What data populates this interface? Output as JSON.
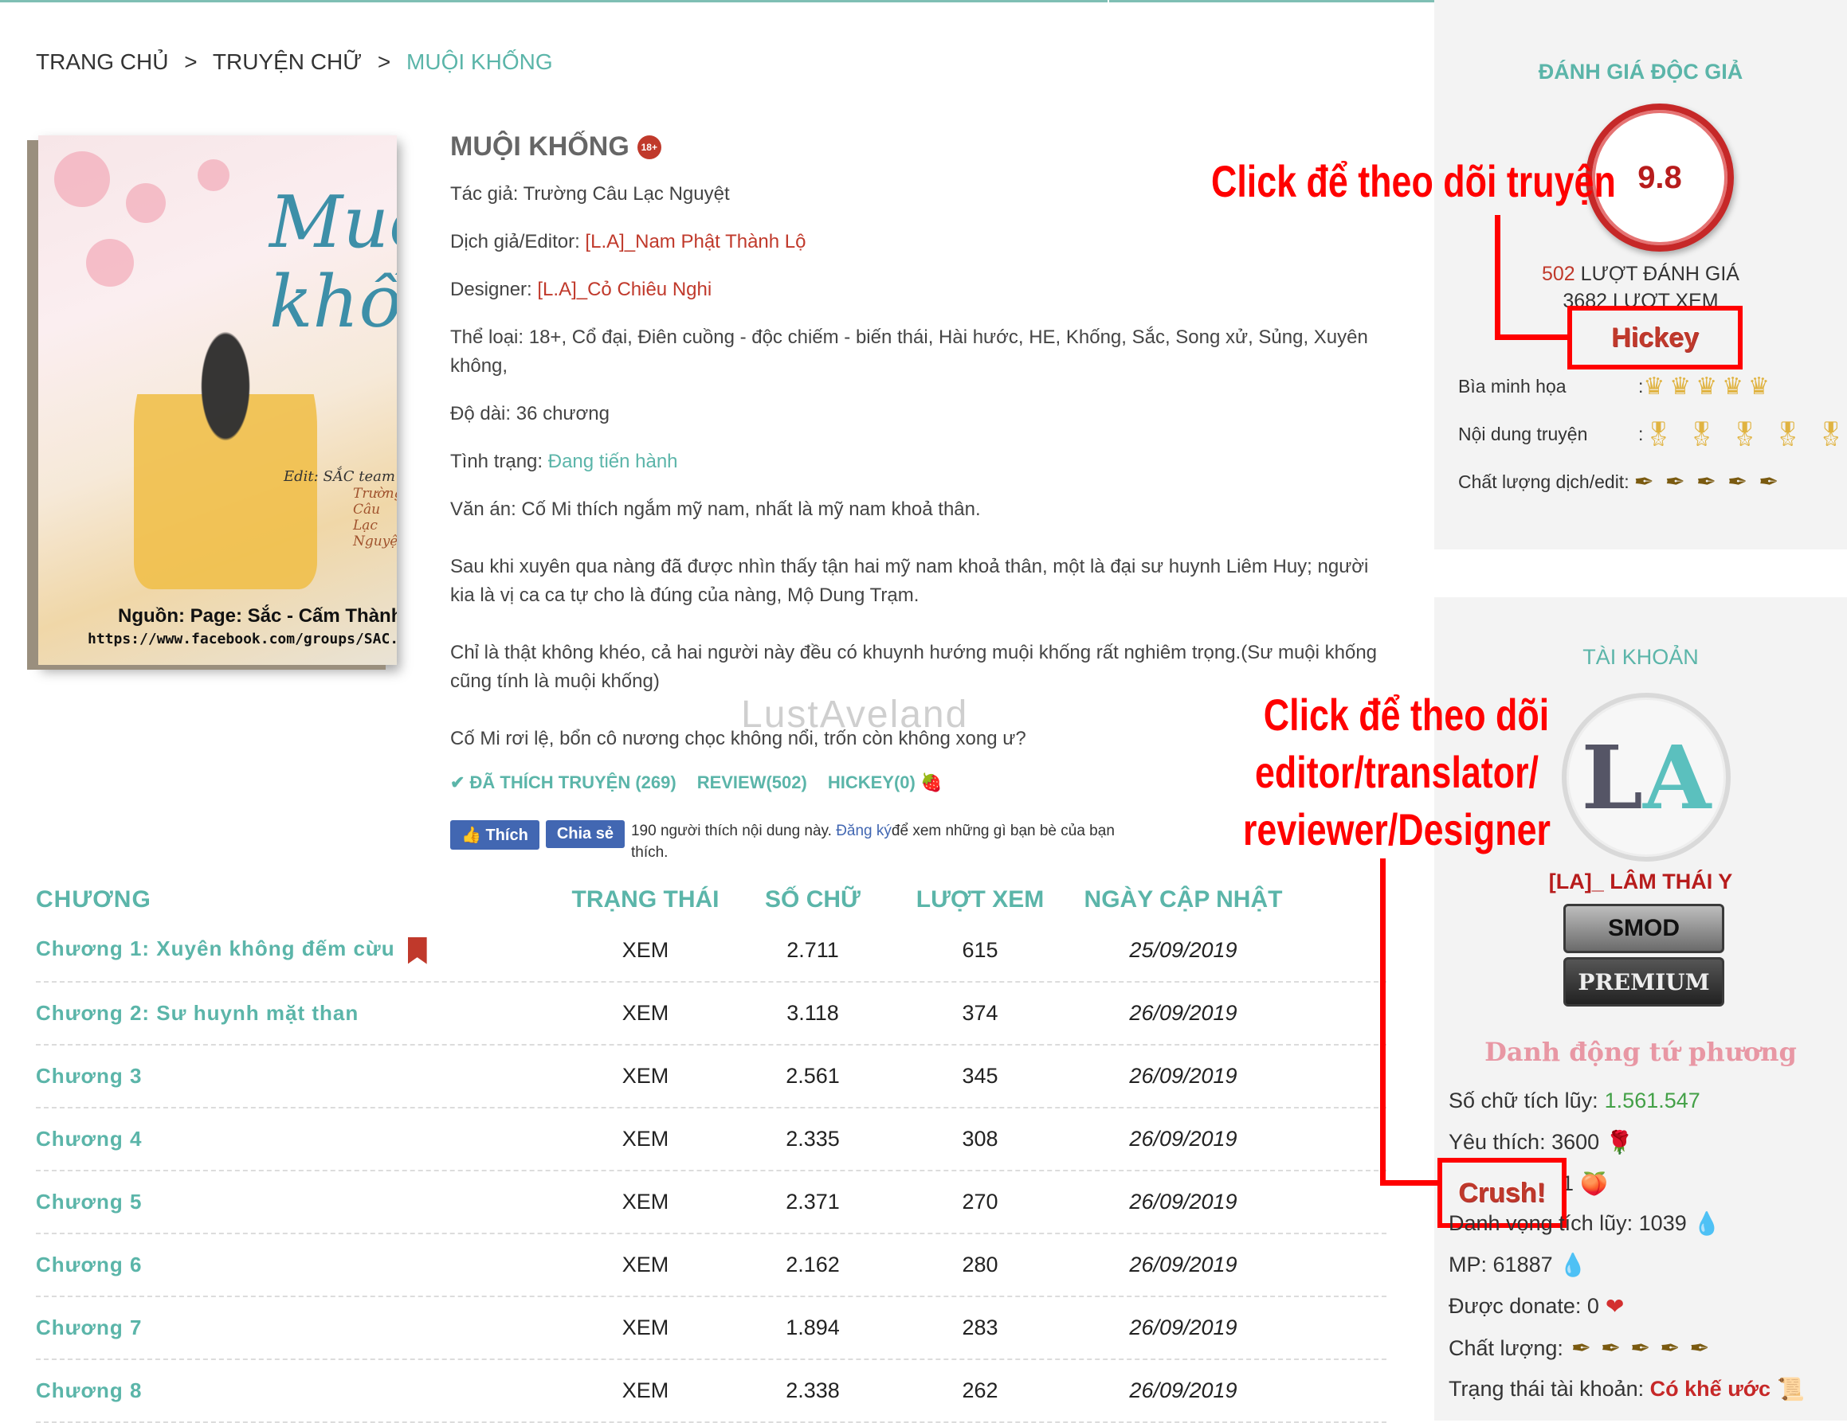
{
  "breadcrumb": {
    "home": "TRANG CHỦ",
    "category": "TRUYỆN CHỮ",
    "current": "MUỘI KHỐNG",
    "sep": ">"
  },
  "book": {
    "title": "MUỘI KHỐNG",
    "age_badge": "18+",
    "author_label": "Tác giả:",
    "author": "Trường Câu Lạc Nguyệt",
    "editor_label": "Dịch giả/Editor:",
    "editor": "[L.A]_Nam Phật Thành Lộ",
    "designer_label": "Designer:",
    "designer": "[L.A]_Cỏ Chiêu Nghi",
    "genre_label": "Thể loại:",
    "genre": "18+, Cổ đại, Điên cuồng - độc chiếm - biến thái, Hài hước, HE, Khống, Sắc, Song xử, Sủng, Xuyên không,",
    "length_label": "Độ dài:",
    "length": "36 chương",
    "status_label": "Tình trạng:",
    "status": "Đang tiến hành",
    "synopsis_label": "Văn án:",
    "synopsis": [
      "Cố Mi thích ngắm mỹ nam, nhất là mỹ nam khoả thân.",
      "Sau khi xuyên qua nàng đã được nhìn thấy tận hai mỹ nam khoả thân, một là đại sư huynh Liêm Huy; người kia là vị ca ca tự cho là đúng của nàng, Mộ Dung Trạm.",
      "Chỉ là thật không khéo, cả hai người này đều có khuynh hướng muội khống rất nghiêm trọng.(Sư muội khống cũng tính là muội khống)",
      "Cố Mi rơi lệ, bổn cô nương chọc không nổi, trốn còn không xong ư?"
    ],
    "cover": {
      "title": "Muội khống",
      "edit": "Edit: SẮC team",
      "author_vertical": "Trường Câu Lạc Nguyệt",
      "source": "Nguồn: Page: Sắc - Cấm Thành",
      "url": "https://www.facebook.com/groups/SAC.CT"
    }
  },
  "actions": {
    "liked": "✔ ĐÃ THÍCH TRUYỆN (269)",
    "review": "REVIEW(502)",
    "hickey": "HICKEY(0)"
  },
  "facebook": {
    "like": "Thích",
    "share": "Chia sẻ",
    "text_before": "190 người thích nội dung này.",
    "signup": "Đăng ký",
    "text_after": "để xem những gì bạn bè của bạn thích."
  },
  "watermark": "LustAveland",
  "table": {
    "headers": {
      "name": "CHƯƠNG",
      "status": "TRẠNG THÁI",
      "words": "SỐ CHỮ",
      "views": "LƯỢT XEM",
      "date": "NGÀY CẬP NHẬT"
    },
    "rows": [
      {
        "name": "Chương 1: Xuyên không đếm cừu",
        "status": "XEM",
        "words": "2.711",
        "views": "615",
        "date": "25/09/2019"
      },
      {
        "name": "Chương 2: Sư huynh mặt than",
        "status": "XEM",
        "words": "3.118",
        "views": "374",
        "date": "26/09/2019"
      },
      {
        "name": "Chương 3",
        "status": "XEM",
        "words": "2.561",
        "views": "345",
        "date": "26/09/2019"
      },
      {
        "name": "Chương 4",
        "status": "XEM",
        "words": "2.335",
        "views": "308",
        "date": "26/09/2019"
      },
      {
        "name": "Chương 5",
        "status": "XEM",
        "words": "2.371",
        "views": "270",
        "date": "26/09/2019"
      },
      {
        "name": "Chương 6",
        "status": "XEM",
        "words": "2.162",
        "views": "280",
        "date": "26/09/2019"
      },
      {
        "name": "Chương 7",
        "status": "XEM",
        "words": "1.894",
        "views": "283",
        "date": "26/09/2019"
      },
      {
        "name": "Chương 8",
        "status": "XEM",
        "words": "2.338",
        "views": "262",
        "date": "26/09/2019"
      }
    ]
  },
  "rating": {
    "title": "ĐÁNH GIÁ ĐỘC GIẢ",
    "score": "9.8",
    "reviews_count": "502",
    "reviews_label": "LƯỢT ĐÁNH GIÁ",
    "views_partial": "3682 LƯỢT XEM",
    "hickey_button": "Hickey",
    "cover_label": "Bìa minh họa",
    "content_label": "Nội dung truyện",
    "quality_label": "Chất lượng dịch/edit",
    "colon": ":"
  },
  "account": {
    "title": "TÀI KHOẢN",
    "name": "[LA]_ LÂM THÁI Y",
    "badge1": "SMOD",
    "badge2": "PREMIUM",
    "tagline": "Danh động tứ phương",
    "words_label": "Số chữ tích lũy:",
    "words": "1.561.547",
    "likes_label": "Yêu thích:",
    "likes": "3600",
    "crush_button": "Crush!",
    "crush_count": "1",
    "fame_label": "Danh vọng tích lũy:",
    "fame": "1039",
    "mp_label": "MP:",
    "mp": "61887",
    "donate_label": "Được donate:",
    "donate": "0",
    "quality_label": "Chất lượng:",
    "account_status_label": "Trạng thái tài khoản:",
    "account_status": "Có khế ước"
  },
  "annotations": {
    "follow_story": "Click để theo dõi truyện",
    "follow_editor_1": "Click để theo dõi",
    "follow_editor_2": "editor/translator/",
    "follow_editor_3": "reviewer/Designer"
  },
  "colors": {
    "accent": "#5bb5a9",
    "red": "#c0392b",
    "annotation": "#ff0000",
    "panel": "#f3f3f3"
  }
}
